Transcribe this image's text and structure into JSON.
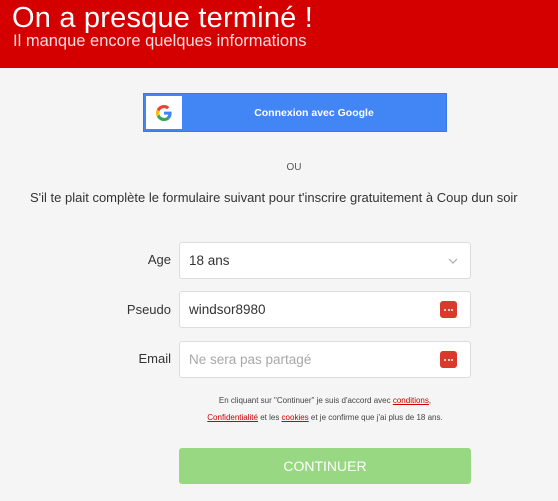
{
  "header": {
    "title": "On a presque terminé !",
    "subtitle": "Il manque encore quelques informations"
  },
  "google": {
    "button_label": "Connexion avec Google",
    "icon": "google-g-icon"
  },
  "separator": "OU",
  "intro": "S'il te plait complète le formulaire suivant pour t'inscrire gratuitement à Coup dun soir",
  "form": {
    "age": {
      "label": "Age",
      "value": "18 ans"
    },
    "pseudo": {
      "label": "Pseudo",
      "value": "windsor8980"
    },
    "email": {
      "label": "Email",
      "value": "",
      "placeholder": "Ne sera pas partagé"
    }
  },
  "terms": {
    "part1": "En cliquant sur \"Continuer\" je suis d'accord avec ",
    "conditions_link": "conditions",
    "comma": ",",
    "confidentialite_link": "Confidentialité",
    "part2": " et les ",
    "cookies_link": "cookies",
    "part3": " et je confirme que j'ai plus de 18 ans."
  },
  "continue_label": "CONTINUER",
  "colors": {
    "header_bg": "#d40000",
    "google_blue": "#4285f4",
    "continue_green": "#98d882",
    "link_red": "#cc0000"
  }
}
